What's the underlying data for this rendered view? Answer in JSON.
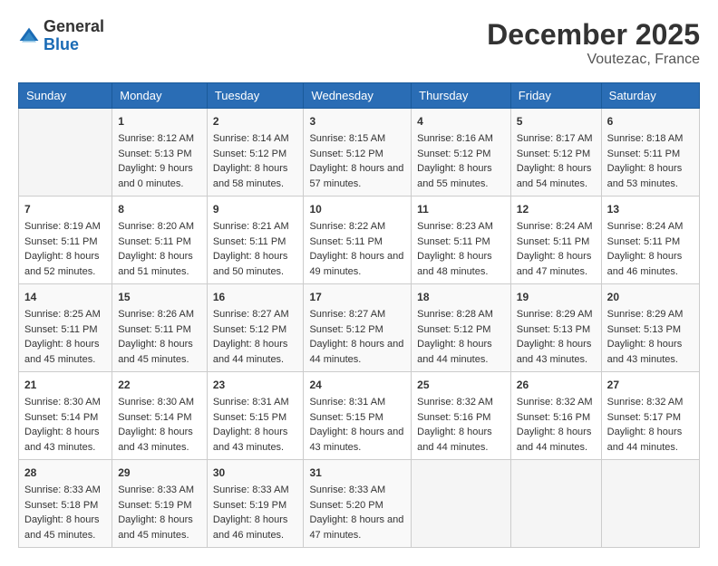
{
  "header": {
    "logo": {
      "general": "General",
      "blue": "Blue"
    },
    "title": "December 2025",
    "location": "Voutezac, France"
  },
  "calendar": {
    "days_of_week": [
      "Sunday",
      "Monday",
      "Tuesday",
      "Wednesday",
      "Thursday",
      "Friday",
      "Saturday"
    ],
    "weeks": [
      [
        {
          "day": "",
          "sunrise": "",
          "sunset": "",
          "daylight": ""
        },
        {
          "day": "1",
          "sunrise": "Sunrise: 8:12 AM",
          "sunset": "Sunset: 5:13 PM",
          "daylight": "Daylight: 9 hours and 0 minutes."
        },
        {
          "day": "2",
          "sunrise": "Sunrise: 8:14 AM",
          "sunset": "Sunset: 5:12 PM",
          "daylight": "Daylight: 8 hours and 58 minutes."
        },
        {
          "day": "3",
          "sunrise": "Sunrise: 8:15 AM",
          "sunset": "Sunset: 5:12 PM",
          "daylight": "Daylight: 8 hours and 57 minutes."
        },
        {
          "day": "4",
          "sunrise": "Sunrise: 8:16 AM",
          "sunset": "Sunset: 5:12 PM",
          "daylight": "Daylight: 8 hours and 55 minutes."
        },
        {
          "day": "5",
          "sunrise": "Sunrise: 8:17 AM",
          "sunset": "Sunset: 5:12 PM",
          "daylight": "Daylight: 8 hours and 54 minutes."
        },
        {
          "day": "6",
          "sunrise": "Sunrise: 8:18 AM",
          "sunset": "Sunset: 5:11 PM",
          "daylight": "Daylight: 8 hours and 53 minutes."
        }
      ],
      [
        {
          "day": "7",
          "sunrise": "Sunrise: 8:19 AM",
          "sunset": "Sunset: 5:11 PM",
          "daylight": "Daylight: 8 hours and 52 minutes."
        },
        {
          "day": "8",
          "sunrise": "Sunrise: 8:20 AM",
          "sunset": "Sunset: 5:11 PM",
          "daylight": "Daylight: 8 hours and 51 minutes."
        },
        {
          "day": "9",
          "sunrise": "Sunrise: 8:21 AM",
          "sunset": "Sunset: 5:11 PM",
          "daylight": "Daylight: 8 hours and 50 minutes."
        },
        {
          "day": "10",
          "sunrise": "Sunrise: 8:22 AM",
          "sunset": "Sunset: 5:11 PM",
          "daylight": "Daylight: 8 hours and 49 minutes."
        },
        {
          "day": "11",
          "sunrise": "Sunrise: 8:23 AM",
          "sunset": "Sunset: 5:11 PM",
          "daylight": "Daylight: 8 hours and 48 minutes."
        },
        {
          "day": "12",
          "sunrise": "Sunrise: 8:24 AM",
          "sunset": "Sunset: 5:11 PM",
          "daylight": "Daylight: 8 hours and 47 minutes."
        },
        {
          "day": "13",
          "sunrise": "Sunrise: 8:24 AM",
          "sunset": "Sunset: 5:11 PM",
          "daylight": "Daylight: 8 hours and 46 minutes."
        }
      ],
      [
        {
          "day": "14",
          "sunrise": "Sunrise: 8:25 AM",
          "sunset": "Sunset: 5:11 PM",
          "daylight": "Daylight: 8 hours and 45 minutes."
        },
        {
          "day": "15",
          "sunrise": "Sunrise: 8:26 AM",
          "sunset": "Sunset: 5:11 PM",
          "daylight": "Daylight: 8 hours and 45 minutes."
        },
        {
          "day": "16",
          "sunrise": "Sunrise: 8:27 AM",
          "sunset": "Sunset: 5:12 PM",
          "daylight": "Daylight: 8 hours and 44 minutes."
        },
        {
          "day": "17",
          "sunrise": "Sunrise: 8:27 AM",
          "sunset": "Sunset: 5:12 PM",
          "daylight": "Daylight: 8 hours and 44 minutes."
        },
        {
          "day": "18",
          "sunrise": "Sunrise: 8:28 AM",
          "sunset": "Sunset: 5:12 PM",
          "daylight": "Daylight: 8 hours and 44 minutes."
        },
        {
          "day": "19",
          "sunrise": "Sunrise: 8:29 AM",
          "sunset": "Sunset: 5:13 PM",
          "daylight": "Daylight: 8 hours and 43 minutes."
        },
        {
          "day": "20",
          "sunrise": "Sunrise: 8:29 AM",
          "sunset": "Sunset: 5:13 PM",
          "daylight": "Daylight: 8 hours and 43 minutes."
        }
      ],
      [
        {
          "day": "21",
          "sunrise": "Sunrise: 8:30 AM",
          "sunset": "Sunset: 5:14 PM",
          "daylight": "Daylight: 8 hours and 43 minutes."
        },
        {
          "day": "22",
          "sunrise": "Sunrise: 8:30 AM",
          "sunset": "Sunset: 5:14 PM",
          "daylight": "Daylight: 8 hours and 43 minutes."
        },
        {
          "day": "23",
          "sunrise": "Sunrise: 8:31 AM",
          "sunset": "Sunset: 5:15 PM",
          "daylight": "Daylight: 8 hours and 43 minutes."
        },
        {
          "day": "24",
          "sunrise": "Sunrise: 8:31 AM",
          "sunset": "Sunset: 5:15 PM",
          "daylight": "Daylight: 8 hours and 43 minutes."
        },
        {
          "day": "25",
          "sunrise": "Sunrise: 8:32 AM",
          "sunset": "Sunset: 5:16 PM",
          "daylight": "Daylight: 8 hours and 44 minutes."
        },
        {
          "day": "26",
          "sunrise": "Sunrise: 8:32 AM",
          "sunset": "Sunset: 5:16 PM",
          "daylight": "Daylight: 8 hours and 44 minutes."
        },
        {
          "day": "27",
          "sunrise": "Sunrise: 8:32 AM",
          "sunset": "Sunset: 5:17 PM",
          "daylight": "Daylight: 8 hours and 44 minutes."
        }
      ],
      [
        {
          "day": "28",
          "sunrise": "Sunrise: 8:33 AM",
          "sunset": "Sunset: 5:18 PM",
          "daylight": "Daylight: 8 hours and 45 minutes."
        },
        {
          "day": "29",
          "sunrise": "Sunrise: 8:33 AM",
          "sunset": "Sunset: 5:19 PM",
          "daylight": "Daylight: 8 hours and 45 minutes."
        },
        {
          "day": "30",
          "sunrise": "Sunrise: 8:33 AM",
          "sunset": "Sunset: 5:19 PM",
          "daylight": "Daylight: 8 hours and 46 minutes."
        },
        {
          "day": "31",
          "sunrise": "Sunrise: 8:33 AM",
          "sunset": "Sunset: 5:20 PM",
          "daylight": "Daylight: 8 hours and 47 minutes."
        },
        {
          "day": "",
          "sunrise": "",
          "sunset": "",
          "daylight": ""
        },
        {
          "day": "",
          "sunrise": "",
          "sunset": "",
          "daylight": ""
        },
        {
          "day": "",
          "sunrise": "",
          "sunset": "",
          "daylight": ""
        }
      ]
    ]
  }
}
